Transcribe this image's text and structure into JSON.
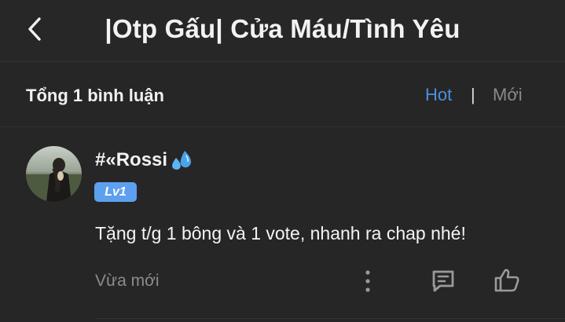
{
  "header": {
    "title": "|Otp Gấu| Cửa Máu/Tình Yêu",
    "back_icon": "chevron-left-icon"
  },
  "comments_bar": {
    "count_label": "Tổng 1 bình luận",
    "sort_hot": "Hot",
    "separator": "|",
    "sort_new": "Mới",
    "active_color": "#4a90e2",
    "inactive_color": "#8a8a8a"
  },
  "comment": {
    "username": "#«Rossi",
    "username_emoji": "sweat-droplets-icon",
    "level": "Lv1",
    "level_color": "#5ea0f0",
    "text": "Tặng t/g 1 bông và 1 vote, nhanh ra chap nhé!",
    "time": "Vừa mới",
    "actions": [
      "more-icon",
      "reply-icon",
      "like-icon"
    ]
  },
  "theme": {
    "background": "#262626",
    "divider": "#333333"
  }
}
